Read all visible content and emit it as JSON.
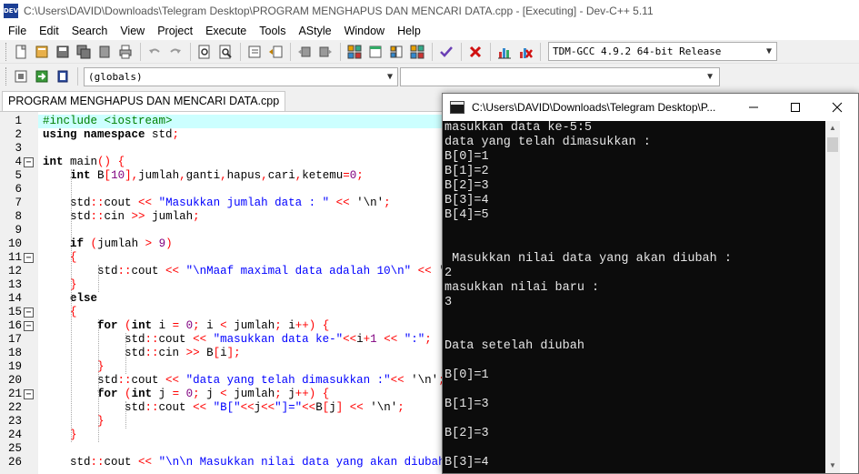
{
  "window": {
    "title": "C:\\Users\\DAVID\\Downloads\\Telegram Desktop\\PROGRAM MENGHAPUS DAN MENCARI DATA.cpp - [Executing] - Dev-C++ 5.11",
    "icon_text": "DEV"
  },
  "menu": [
    "File",
    "Edit",
    "Search",
    "View",
    "Project",
    "Execute",
    "Tools",
    "AStyle",
    "Window",
    "Help"
  ],
  "toolbar": {
    "compiler": "TDM-GCC 4.9.2 64-bit Release",
    "scope": "(globals)"
  },
  "editor_tab": "PROGRAM MENGHAPUS DAN MENCARI DATA.cpp",
  "code_lines": [
    {
      "n": "1",
      "t": [
        [
          "pp",
          "#include <iostream>"
        ]
      ]
    },
    {
      "n": "2",
      "t": [
        [
          "kw",
          "using namespace"
        ],
        [
          "pl",
          " std"
        ],
        [
          "sym",
          ";"
        ]
      ]
    },
    {
      "n": "3",
      "t": []
    },
    {
      "n": "4",
      "t": [
        [
          "kw",
          "int"
        ],
        [
          "pl",
          " main"
        ],
        [
          "sym",
          "()"
        ],
        [
          "pl",
          " "
        ],
        [
          "sym",
          "{"
        ]
      ]
    },
    {
      "n": "5",
      "t": [
        [
          "pl",
          "    "
        ],
        [
          "kw",
          "int"
        ],
        [
          "pl",
          " B"
        ],
        [
          "sym",
          "["
        ],
        [
          "num",
          "10"
        ],
        [
          "sym",
          "],"
        ],
        [
          "pl",
          "jumlah"
        ],
        [
          "sym",
          ","
        ],
        [
          "pl",
          "ganti"
        ],
        [
          "sym",
          ","
        ],
        [
          "pl",
          "hapus"
        ],
        [
          "sym",
          ","
        ],
        [
          "pl",
          "cari"
        ],
        [
          "sym",
          ","
        ],
        [
          "pl",
          "ketemu"
        ],
        [
          "sym",
          "="
        ],
        [
          "num",
          "0"
        ],
        [
          "sym",
          ";"
        ]
      ]
    },
    {
      "n": "6",
      "t": []
    },
    {
      "n": "7",
      "t": [
        [
          "pl",
          "    std"
        ],
        [
          "sym",
          "::"
        ],
        [
          "pl",
          "cout "
        ],
        [
          "sym",
          "<<"
        ],
        [
          "pl",
          " "
        ],
        [
          "str",
          "\"Masukkan jumlah data : \""
        ],
        [
          "pl",
          " "
        ],
        [
          "sym",
          "<<"
        ],
        [
          "pl",
          " '\\n'"
        ],
        [
          "sym",
          ";"
        ]
      ]
    },
    {
      "n": "8",
      "t": [
        [
          "pl",
          "    std"
        ],
        [
          "sym",
          "::"
        ],
        [
          "pl",
          "cin "
        ],
        [
          "sym",
          ">>"
        ],
        [
          "pl",
          " jumlah"
        ],
        [
          "sym",
          ";"
        ]
      ]
    },
    {
      "n": "9",
      "t": []
    },
    {
      "n": "10",
      "t": [
        [
          "pl",
          "    "
        ],
        [
          "kw",
          "if"
        ],
        [
          "pl",
          " "
        ],
        [
          "sym",
          "("
        ],
        [
          "pl",
          "jumlah "
        ],
        [
          "sym",
          ">"
        ],
        [
          "pl",
          " "
        ],
        [
          "num",
          "9"
        ],
        [
          "sym",
          ")"
        ]
      ]
    },
    {
      "n": "11",
      "t": [
        [
          "pl",
          "    "
        ],
        [
          "sym",
          "{"
        ]
      ]
    },
    {
      "n": "12",
      "t": [
        [
          "pl",
          "        std"
        ],
        [
          "sym",
          "::"
        ],
        [
          "pl",
          "cout "
        ],
        [
          "sym",
          "<<"
        ],
        [
          "pl",
          " "
        ],
        [
          "str",
          "\"\\nMaaf maximal data adalah 10\\n\""
        ],
        [
          "pl",
          " "
        ],
        [
          "sym",
          "<<"
        ],
        [
          "pl",
          " '\\n'"
        ],
        [
          "sym",
          ";"
        ]
      ]
    },
    {
      "n": "13",
      "t": [
        [
          "pl",
          "    "
        ],
        [
          "sym",
          "}"
        ]
      ]
    },
    {
      "n": "14",
      "t": [
        [
          "pl",
          "    "
        ],
        [
          "kw",
          "else"
        ]
      ]
    },
    {
      "n": "15",
      "t": [
        [
          "pl",
          "    "
        ],
        [
          "sym",
          "{"
        ]
      ]
    },
    {
      "n": "16",
      "t": [
        [
          "pl",
          "        "
        ],
        [
          "kw",
          "for"
        ],
        [
          "pl",
          " "
        ],
        [
          "sym",
          "("
        ],
        [
          "kw",
          "int"
        ],
        [
          "pl",
          " i "
        ],
        [
          "sym",
          "="
        ],
        [
          "pl",
          " "
        ],
        [
          "num",
          "0"
        ],
        [
          "sym",
          ";"
        ],
        [
          "pl",
          " i "
        ],
        [
          "sym",
          "<"
        ],
        [
          "pl",
          " jumlah"
        ],
        [
          "sym",
          ";"
        ],
        [
          "pl",
          " i"
        ],
        [
          "sym",
          "++)"
        ],
        [
          "pl",
          " "
        ],
        [
          "sym",
          "{"
        ]
      ]
    },
    {
      "n": "17",
      "t": [
        [
          "pl",
          "            std"
        ],
        [
          "sym",
          "::"
        ],
        [
          "pl",
          "cout "
        ],
        [
          "sym",
          "<<"
        ],
        [
          "pl",
          " "
        ],
        [
          "str",
          "\"masukkan data ke-\""
        ],
        [
          "sym",
          "<<"
        ],
        [
          "pl",
          "i"
        ],
        [
          "sym",
          "+"
        ],
        [
          "num",
          "1"
        ],
        [
          "pl",
          " "
        ],
        [
          "sym",
          "<<"
        ],
        [
          "pl",
          " "
        ],
        [
          "str",
          "\":\""
        ],
        [
          "sym",
          ";"
        ]
      ]
    },
    {
      "n": "18",
      "t": [
        [
          "pl",
          "            std"
        ],
        [
          "sym",
          "::"
        ],
        [
          "pl",
          "cin "
        ],
        [
          "sym",
          ">>"
        ],
        [
          "pl",
          " B"
        ],
        [
          "sym",
          "["
        ],
        [
          "pl",
          "i"
        ],
        [
          "sym",
          "];"
        ]
      ]
    },
    {
      "n": "19",
      "t": [
        [
          "pl",
          "        "
        ],
        [
          "sym",
          "}"
        ]
      ]
    },
    {
      "n": "20",
      "t": [
        [
          "pl",
          "        std"
        ],
        [
          "sym",
          "::"
        ],
        [
          "pl",
          "cout "
        ],
        [
          "sym",
          "<<"
        ],
        [
          "pl",
          " "
        ],
        [
          "str",
          "\"data yang telah dimasukkan :\""
        ],
        [
          "sym",
          "<<"
        ],
        [
          "pl",
          " '\\n'"
        ],
        [
          "sym",
          ";"
        ]
      ]
    },
    {
      "n": "21",
      "t": [
        [
          "pl",
          "        "
        ],
        [
          "kw",
          "for"
        ],
        [
          "pl",
          " "
        ],
        [
          "sym",
          "("
        ],
        [
          "kw",
          "int"
        ],
        [
          "pl",
          " j "
        ],
        [
          "sym",
          "="
        ],
        [
          "pl",
          " "
        ],
        [
          "num",
          "0"
        ],
        [
          "sym",
          ";"
        ],
        [
          "pl",
          " j "
        ],
        [
          "sym",
          "<"
        ],
        [
          "pl",
          " jumlah"
        ],
        [
          "sym",
          ";"
        ],
        [
          "pl",
          " j"
        ],
        [
          "sym",
          "++)"
        ],
        [
          "pl",
          " "
        ],
        [
          "sym",
          "{"
        ]
      ]
    },
    {
      "n": "22",
      "t": [
        [
          "pl",
          "            std"
        ],
        [
          "sym",
          "::"
        ],
        [
          "pl",
          "cout "
        ],
        [
          "sym",
          "<<"
        ],
        [
          "pl",
          " "
        ],
        [
          "str",
          "\"B[\""
        ],
        [
          "sym",
          "<<"
        ],
        [
          "pl",
          "j"
        ],
        [
          "sym",
          "<<"
        ],
        [
          "str",
          "\"]=\""
        ],
        [
          "sym",
          "<<"
        ],
        [
          "pl",
          "B"
        ],
        [
          "sym",
          "["
        ],
        [
          "pl",
          "j"
        ],
        [
          "sym",
          "]"
        ],
        [
          "pl",
          " "
        ],
        [
          "sym",
          "<<"
        ],
        [
          "pl",
          " '\\n'"
        ],
        [
          "sym",
          ";"
        ]
      ]
    },
    {
      "n": "23",
      "t": [
        [
          "pl",
          "        "
        ],
        [
          "sym",
          "}"
        ]
      ]
    },
    {
      "n": "24",
      "t": [
        [
          "pl",
          "    "
        ],
        [
          "sym",
          "}"
        ]
      ]
    },
    {
      "n": "25",
      "t": []
    },
    {
      "n": "26",
      "t": [
        [
          "pl",
          "    std"
        ],
        [
          "sym",
          "::"
        ],
        [
          "pl",
          "cout "
        ],
        [
          "sym",
          "<<"
        ],
        [
          "pl",
          " "
        ],
        [
          "str",
          "\"\\n\\n Masukkan nilai data yang akan diubah :\""
        ]
      ]
    }
  ],
  "console": {
    "title": "C:\\Users\\DAVID\\Downloads\\Telegram Desktop\\P...",
    "lines": [
      "masukkan data ke-5:5",
      "data yang telah dimasukkan :",
      "B[0]=1",
      "B[1]=2",
      "B[2]=3",
      "B[3]=4",
      "B[4]=5",
      "",
      "",
      " Masukkan nilai data yang akan diubah :",
      "2",
      "masukkan nilai baru :",
      "3",
      "",
      "",
      "Data setelah diubah",
      "",
      "B[0]=1",
      "",
      "B[1]=3",
      "",
      "B[2]=3",
      "",
      "B[3]=4"
    ]
  },
  "colors": {
    "current_line": "#ccffff",
    "preprocessor": "#008000",
    "string": "#0000ff",
    "number": "#800080",
    "symbol": "#ff0000",
    "console_bg": "#0c0c0c",
    "console_fg": "#e6e6e6"
  }
}
